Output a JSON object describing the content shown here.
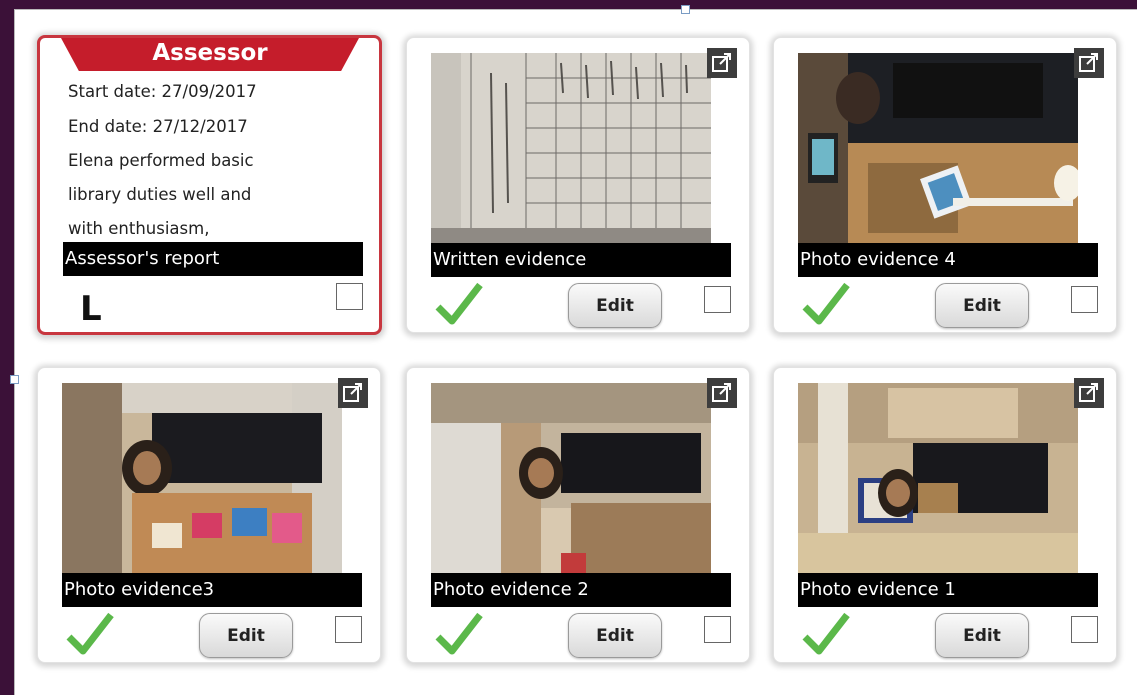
{
  "assessor_card": {
    "title": "Assessor",
    "start_date": "Start date: 27/09/2017",
    "end_date": "End date: 27/12/2017",
    "report_lines": [
      "Elena performed basic",
      "library duties well and",
      "with enthusiasm,"
    ],
    "caption": "Assessor's report",
    "mark": "L"
  },
  "evidence": [
    {
      "caption": "Written evidence",
      "edit_label": "Edit",
      "photo_kind": "written",
      "approved": true
    },
    {
      "caption": "Photo evidence 4",
      "edit_label": "Edit",
      "photo_kind": "photo4",
      "approved": true
    },
    {
      "caption": "Photo evidence3",
      "edit_label": "Edit",
      "photo_kind": "photo3",
      "approved": true
    },
    {
      "caption": "Photo evidence 2",
      "edit_label": "Edit",
      "photo_kind": "photo2",
      "approved": true
    },
    {
      "caption": "Photo evidence 1",
      "edit_label": "Edit",
      "photo_kind": "photo1",
      "approved": true
    }
  ],
  "icons": {
    "expand": "external-link-icon",
    "approved": "check-mark-icon",
    "select": "checkbox-icon"
  },
  "colors": {
    "window_frame": "#3b1138",
    "banner": "#c51d2b",
    "assessor_border": "#c8363f",
    "tick": "#5bb84a",
    "caption_bg": "#000000"
  }
}
